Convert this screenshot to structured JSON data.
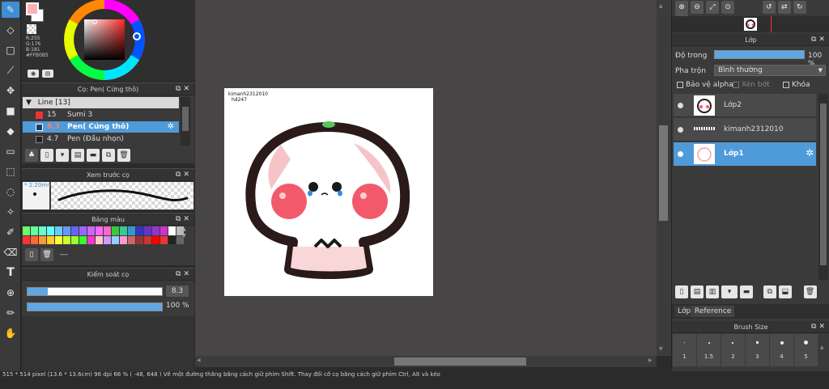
{
  "colors": {
    "accent": "#3d8fd4",
    "foreground": "#FFB0B5",
    "selected_brush": "#ff6b6b"
  },
  "color_picker": {
    "r": "R:255",
    "g": "G:176",
    "b": "B:181",
    "hex": "#FFB0B5"
  },
  "brush_panel": {
    "title": "Cọ: Pen( Cứng thô)",
    "group": "Line [13]",
    "items": [
      {
        "size": "15",
        "name": "Sumi 3"
      },
      {
        "size": "8.3",
        "name": "Pen( Cứng thô)"
      },
      {
        "size": "4.7",
        "name": "Pen (Đầu nhọn)"
      }
    ]
  },
  "preview_panel": {
    "title": "Xem trước cọ",
    "size": "* 2.20mm"
  },
  "palette_panel": {
    "title": "Bảng màu",
    "more": "---"
  },
  "brush_control": {
    "title": "Kiểm soát cọ",
    "size_value": "8.3",
    "opacity_value": "100 %",
    "size_fraction": 0.15,
    "opacity_fraction": 1.0
  },
  "canvas": {
    "text1": "kimanh2312010",
    "text2": "hd247"
  },
  "layers_panel": {
    "title": "Lớp",
    "opacity_label": "Độ trong",
    "opacity_value": "100 %",
    "blend_label": "Pha trộn",
    "blend_value": "Bình thường",
    "protect_alpha": "Bảo vệ alpha",
    "clipping": "Xén bớt",
    "lock": "Khóa",
    "layers": [
      {
        "name": "Lớp2"
      },
      {
        "name": "kimanh2312010"
      },
      {
        "name": "Lớp1"
      }
    ],
    "tab_layers": "Lớp",
    "tab_reference": "Reference"
  },
  "brush_size_panel": {
    "title": "Brush Size",
    "sizes": [
      "1",
      "1.5",
      "2",
      "3",
      "4",
      "5"
    ]
  },
  "status": "515 * 514 pixel  (13.6 * 13.6cm)  96 dpi  66 %  ( -48, 648 )  Vẽ một đường thẳng bằng cách giữ phím Shift. Thay đổi cỡ cọ bằng cách giữ phím Ctrl, Alt và kéo"
}
